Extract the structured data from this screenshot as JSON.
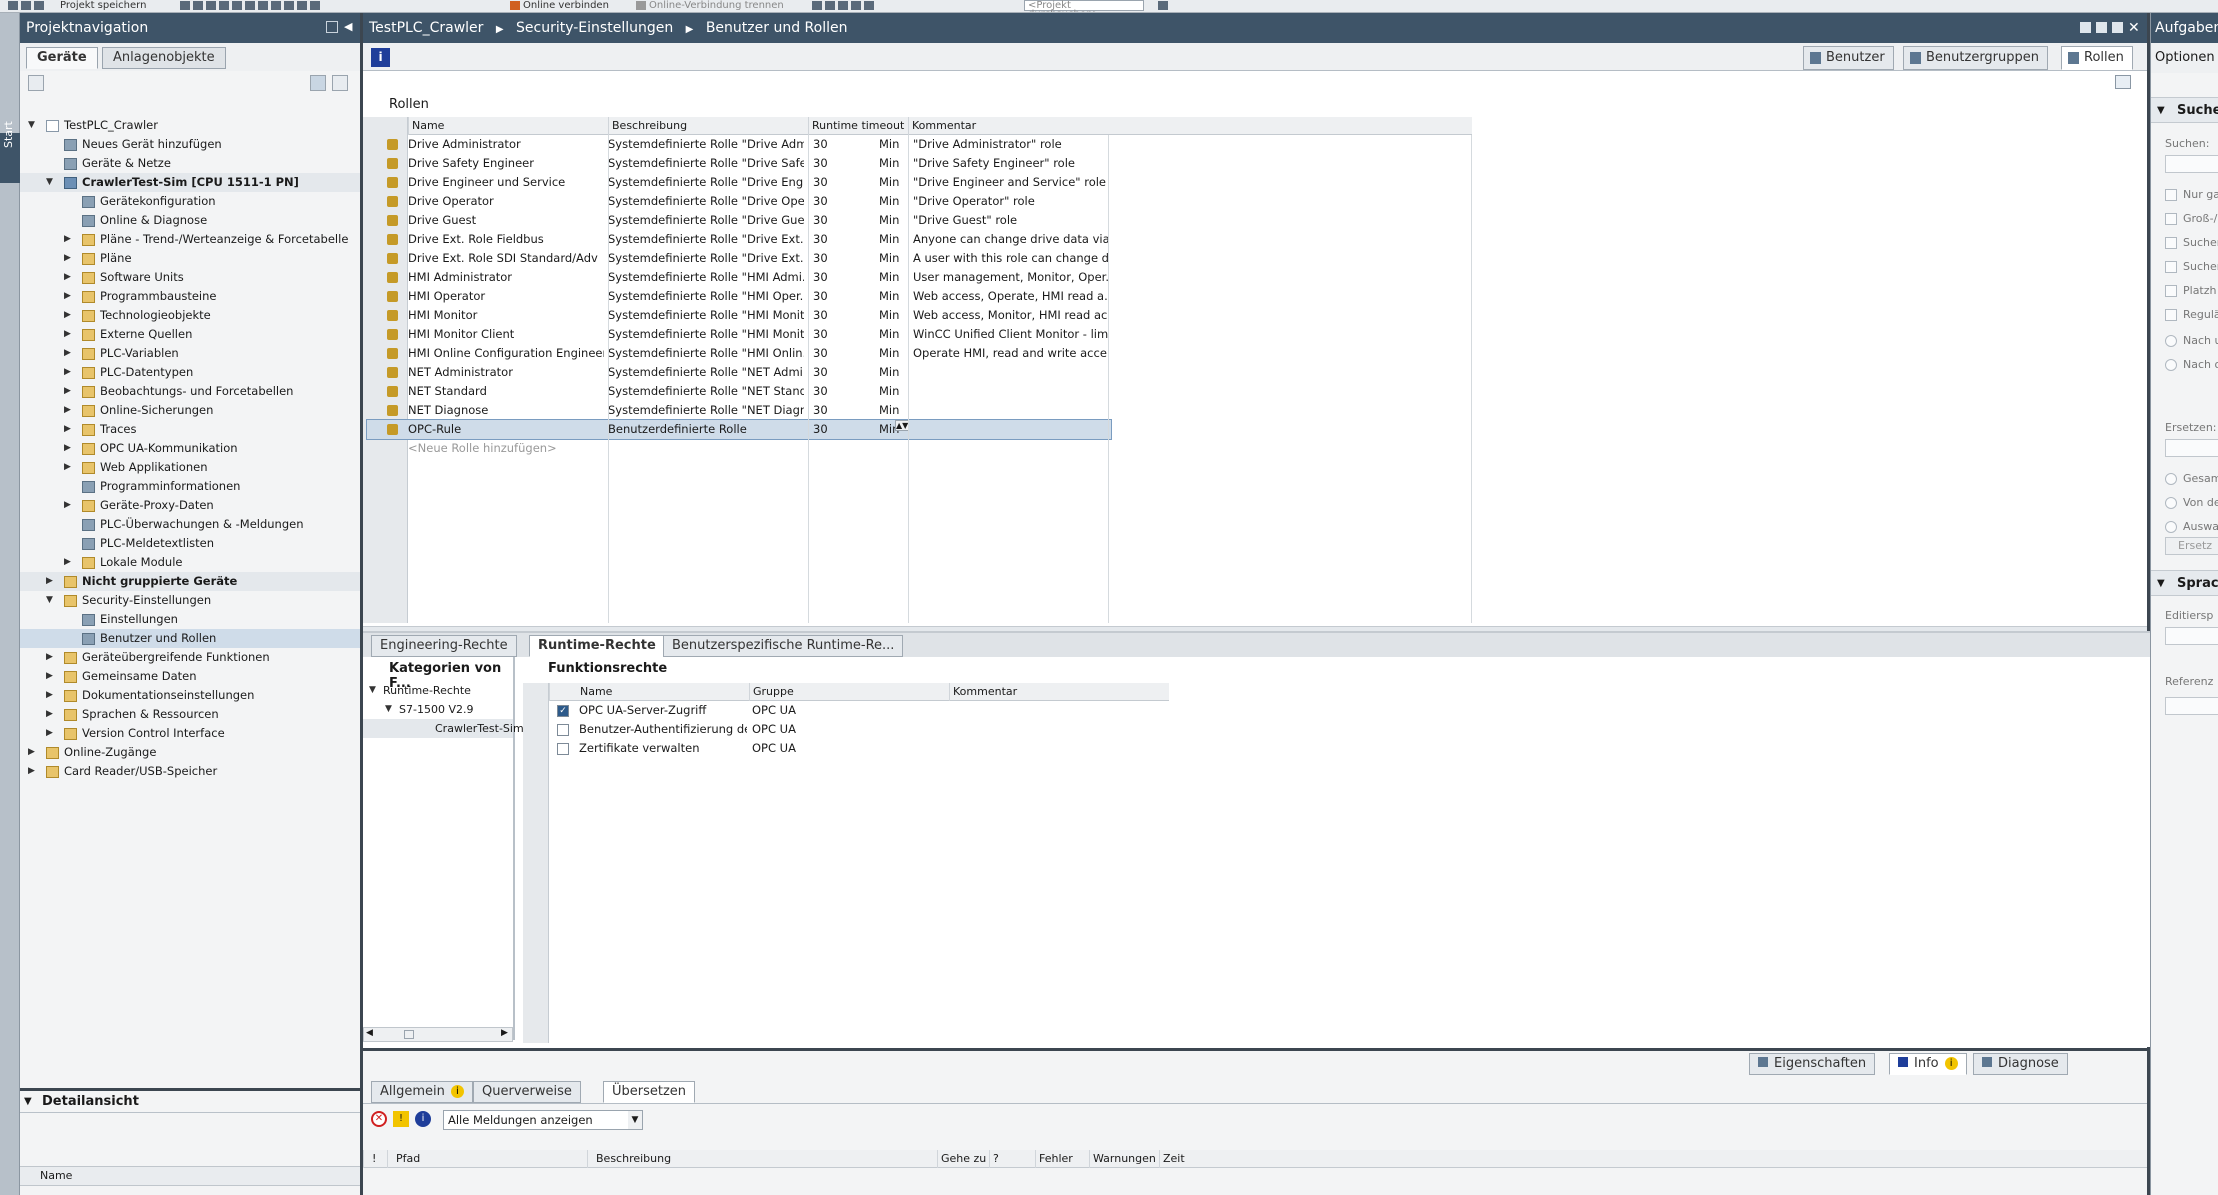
{
  "toolbar": {
    "save_project": "Projekt speichern",
    "online_connect": "Online verbinden",
    "online_disconnect": "Online-Verbindung trennen",
    "search_placeholder": "<Projekt durchsuchen>"
  },
  "start_tab": "Start",
  "nav": {
    "title": "Projektnavigation",
    "tab_devices": "Geräte",
    "tab_plant_objects": "Anlagenobjekte",
    "tree": [
      {
        "label": "TestPLC_Crawler",
        "level": 0,
        "arrow": "▼",
        "icon": "page"
      },
      {
        "label": "Neues Gerät hinzufügen",
        "level": 1,
        "arrow": "",
        "icon": "gen"
      },
      {
        "label": "Geräte & Netze",
        "level": 1,
        "arrow": "",
        "icon": "gen"
      },
      {
        "label": "CrawlerTest-Sim [CPU 1511-1 PN]",
        "level": 1,
        "arrow": "▼",
        "icon": "dev",
        "bold": true,
        "hl": true
      },
      {
        "label": "Gerätekonfiguration",
        "level": 2,
        "arrow": "",
        "icon": "gen"
      },
      {
        "label": "Online & Diagnose",
        "level": 2,
        "arrow": "",
        "icon": "gen"
      },
      {
        "label": "Pläne - Trend-/Werteanzeige & Forcetabelle",
        "level": 2,
        "arrow": "▶",
        "icon": "folder"
      },
      {
        "label": "Pläne",
        "level": 2,
        "arrow": "▶",
        "icon": "folder"
      },
      {
        "label": "Software Units",
        "level": 2,
        "arrow": "▶",
        "icon": "folder"
      },
      {
        "label": "Programmbausteine",
        "level": 2,
        "arrow": "▶",
        "icon": "folder"
      },
      {
        "label": "Technologieobjekte",
        "level": 2,
        "arrow": "▶",
        "icon": "folder"
      },
      {
        "label": "Externe Quellen",
        "level": 2,
        "arrow": "▶",
        "icon": "folder"
      },
      {
        "label": "PLC-Variablen",
        "level": 2,
        "arrow": "▶",
        "icon": "folder"
      },
      {
        "label": "PLC-Datentypen",
        "level": 2,
        "arrow": "▶",
        "icon": "folder"
      },
      {
        "label": "Beobachtungs- und Forcetabellen",
        "level": 2,
        "arrow": "▶",
        "icon": "folder"
      },
      {
        "label": "Online-Sicherungen",
        "level": 2,
        "arrow": "▶",
        "icon": "folder"
      },
      {
        "label": "Traces",
        "level": 2,
        "arrow": "▶",
        "icon": "folder"
      },
      {
        "label": "OPC UA-Kommunikation",
        "level": 2,
        "arrow": "▶",
        "icon": "folder"
      },
      {
        "label": "Web Applikationen",
        "level": 2,
        "arrow": "▶",
        "icon": "folder"
      },
      {
        "label": "Programminformationen",
        "level": 2,
        "arrow": "",
        "icon": "gen"
      },
      {
        "label": "Geräte-Proxy-Daten",
        "level": 2,
        "arrow": "▶",
        "icon": "folder"
      },
      {
        "label": "PLC-Überwachungen & -Meldungen",
        "level": 2,
        "arrow": "",
        "icon": "gen"
      },
      {
        "label": "PLC-Meldetextlisten",
        "level": 2,
        "arrow": "",
        "icon": "gen"
      },
      {
        "label": "Lokale Module",
        "level": 2,
        "arrow": "▶",
        "icon": "folder"
      },
      {
        "label": "Nicht gruppierte Geräte",
        "level": 1,
        "arrow": "▶",
        "icon": "folder",
        "bold": true,
        "hl": true
      },
      {
        "label": "Security-Einstellungen",
        "level": 1,
        "arrow": "▼",
        "icon": "folder"
      },
      {
        "label": "Einstellungen",
        "level": 2,
        "arrow": "",
        "icon": "gen"
      },
      {
        "label": "Benutzer und Rollen",
        "level": 2,
        "arrow": "",
        "icon": "gen",
        "selected": true
      },
      {
        "label": "Geräteübergreifende Funktionen",
        "level": 1,
        "arrow": "▶",
        "icon": "folder"
      },
      {
        "label": "Gemeinsame Daten",
        "level": 1,
        "arrow": "▶",
        "icon": "folder"
      },
      {
        "label": "Dokumentationseinstellungen",
        "level": 1,
        "arrow": "▶",
        "icon": "folder"
      },
      {
        "label": "Sprachen & Ressourcen",
        "level": 1,
        "arrow": "▶",
        "icon": "folder"
      },
      {
        "label": "Version Control Interface",
        "level": 1,
        "arrow": "▶",
        "icon": "folder"
      },
      {
        "label": "Online-Zugänge",
        "level": 0,
        "arrow": "▶",
        "icon": "folder"
      },
      {
        "label": "Card Reader/USB-Speicher",
        "level": 0,
        "arrow": "▶",
        "icon": "folder"
      }
    ]
  },
  "detail": {
    "title": "Detailansicht",
    "col_name": "Name"
  },
  "editor": {
    "breadcrumb": [
      "TestPLC_Crawler",
      "Security-Einstellungen",
      "Benutzer und Rollen"
    ],
    "tab_users": "Benutzer",
    "tab_groups": "Benutzergruppen",
    "tab_roles": "Rollen",
    "roles_title": "Rollen",
    "columns": {
      "name": "Name",
      "description": "Beschreibung",
      "timeout": "Runtime timeout",
      "comment": "Kommentar"
    },
    "roles": [
      {
        "name": "Drive Administrator",
        "desc": "Systemdefinierte Rolle \"Drive Adm...",
        "timeout": "30",
        "unit": "Min",
        "comment": "\"Drive Administrator\" role"
      },
      {
        "name": "Drive Safety Engineer",
        "desc": "Systemdefinierte Rolle \"Drive Safe...",
        "timeout": "30",
        "unit": "Min",
        "comment": "\"Drive Safety Engineer\" role"
      },
      {
        "name": "Drive Engineer und Service",
        "desc": "Systemdefinierte Rolle \"Drive Engi...",
        "timeout": "30",
        "unit": "Min",
        "comment": "\"Drive Engineer and Service\" role"
      },
      {
        "name": "Drive Operator",
        "desc": "Systemdefinierte Rolle \"Drive Ope...",
        "timeout": "30",
        "unit": "Min",
        "comment": "\"Drive Operator\" role"
      },
      {
        "name": "Drive Guest",
        "desc": "Systemdefinierte Rolle \"Drive Gue...",
        "timeout": "30",
        "unit": "Min",
        "comment": "\"Drive Guest\" role"
      },
      {
        "name": "Drive Ext. Role Fieldbus",
        "desc": "Systemdefinierte Rolle \"Drive Ext. ...",
        "timeout": "30",
        "unit": "Min",
        "comment": "Anyone can change drive data via..."
      },
      {
        "name": "Drive Ext. Role SDI Standard/Adv",
        "desc": "Systemdefinierte Rolle \"Drive Ext. ...",
        "timeout": "30",
        "unit": "Min",
        "comment": "A user with this role can change d..."
      },
      {
        "name": "HMI Administrator",
        "desc": "Systemdefinierte Rolle \"HMI Admi...",
        "timeout": "30",
        "unit": "Min",
        "comment": "User management, Monitor, Oper..."
      },
      {
        "name": "HMI Operator",
        "desc": "Systemdefinierte Rolle \"HMI Oper...",
        "timeout": "30",
        "unit": "Min",
        "comment": "Web access, Operate, HMI read a..."
      },
      {
        "name": "HMI Monitor",
        "desc": "Systemdefinierte Rolle \"HMI Monit...",
        "timeout": "30",
        "unit": "Min",
        "comment": "Web access, Monitor, HMI read ac..."
      },
      {
        "name": "HMI Monitor Client",
        "desc": "Systemdefinierte Rolle \"HMI Monit...",
        "timeout": "30",
        "unit": "Min",
        "comment": "WinCC Unified Client Monitor - limi..."
      },
      {
        "name": "HMI Online Configuration Engineer",
        "desc": "Systemdefinierte Rolle \"HMI Onlin...",
        "timeout": "30",
        "unit": "Min",
        "comment": "Operate HMI, read and write acce..."
      },
      {
        "name": "NET Administrator",
        "desc": "Systemdefinierte Rolle \"NET Admi...",
        "timeout": "30",
        "unit": "Min",
        "comment": ""
      },
      {
        "name": "NET Standard",
        "desc": "Systemdefinierte Rolle \"NET Stand...",
        "timeout": "30",
        "unit": "Min",
        "comment": ""
      },
      {
        "name": "NET Diagnose",
        "desc": "Systemdefinierte Rolle \"NET Diagn...",
        "timeout": "30",
        "unit": "Min",
        "comment": ""
      },
      {
        "name": "OPC-Rule",
        "desc": "Benutzerdefinierte Rolle",
        "timeout": "30",
        "unit": "Min",
        "comment": "",
        "editing": true
      }
    ],
    "add_role": "<Neue Rolle hinzufügen>",
    "lower_tabs": {
      "engineering": "Engineering-Rechte",
      "runtime": "Runtime-Rechte",
      "user_runtime": "Benutzerspezifische Runtime-Re..."
    },
    "categories_title": "Kategorien von F...",
    "function_rights_title": "Funktionsrechte",
    "categories": [
      {
        "label": "Runtime-Rechte",
        "level": 0
      },
      {
        "label": "S7-1500 V2.9",
        "level": 1
      },
      {
        "label": "CrawlerTest-Sim",
        "level": 2
      }
    ],
    "rights_columns": {
      "name": "Name",
      "group": "Gruppe",
      "comment": "Kommentar"
    },
    "rights": [
      {
        "name": "OPC UA-Server-Zugriff",
        "group": "OPC UA",
        "checked": true
      },
      {
        "name": "Benutzer-Authentifizierung des OP...",
        "group": "OPC UA",
        "checked": false
      },
      {
        "name": "Zertifikate verwalten",
        "group": "OPC UA",
        "checked": false
      }
    ]
  },
  "inspector": {
    "tab_properties": "Eigenschaften",
    "tab_info": "Info",
    "tab_diagnose": "Diagnose",
    "tab_general": "Allgemein",
    "tab_crossref": "Querverweise",
    "tab_translate": "Übersetzen",
    "filter_value": "Alle Meldungen anzeigen",
    "columns": {
      "excl": "!",
      "path": "Pfad",
      "desc": "Beschreibung",
      "goto": "Gehe zu",
      "q": "?",
      "errors": "Fehler",
      "warnings": "Warnungen",
      "time": "Zeit"
    }
  },
  "tasks": {
    "title": "Aufgaben",
    "options": "Optionen",
    "search_section": "Suchen",
    "search_label": "Suchen:",
    "checks": [
      "Nur ga",
      "Groß-/",
      "Suchen",
      "Suchen",
      "Platzh",
      "Regulä"
    ],
    "radios1": [
      "Nach u",
      "Nach o"
    ],
    "replace_label": "Ersetzen:",
    "radios2": [
      "Gesam",
      "Von de",
      "Auswa"
    ],
    "replace_button": "Ersetz",
    "languages_section": "Sprach",
    "edit_label": "Editiersp",
    "ref_label": "Referenz"
  }
}
